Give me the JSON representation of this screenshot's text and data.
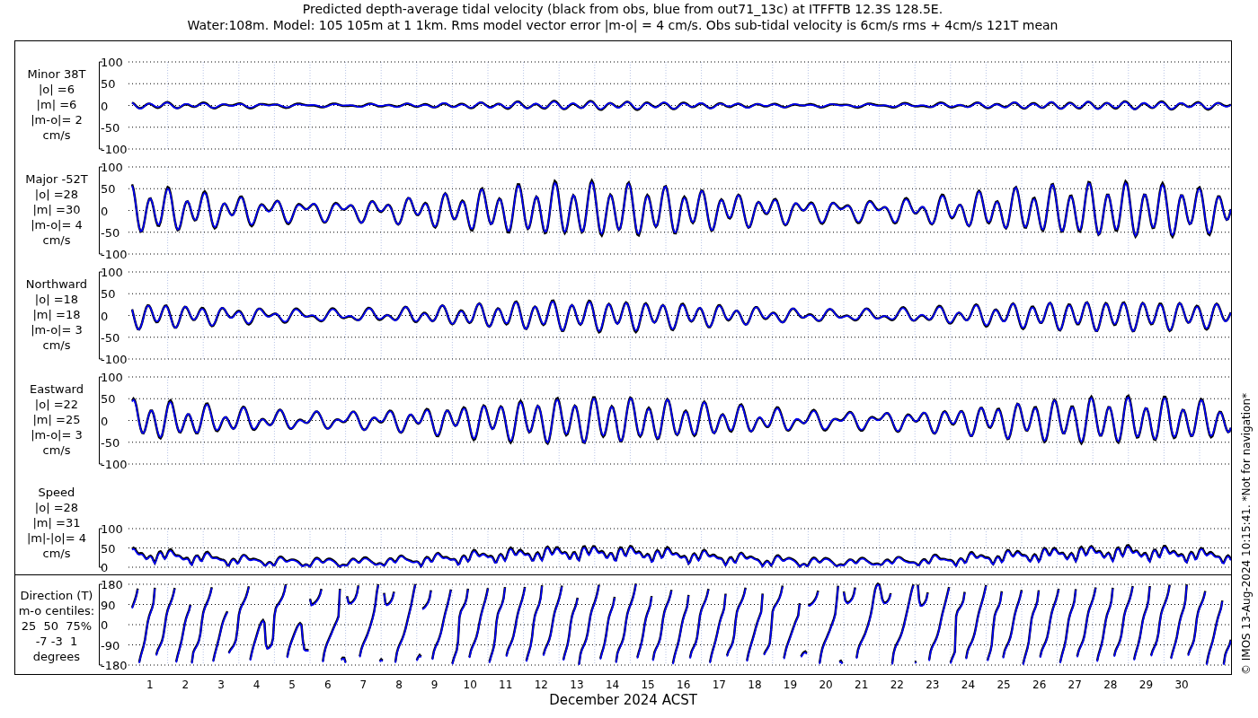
{
  "title": [
    "Predicted depth-average tidal velocity (black from obs, blue from out71_13c) at ITFFTB 12.3S 128.5E.",
    "Water:108m. Model: 105 105m at 1 1km. Rms model vector error |m-o| = 4 cm/s. Obs sub-tidal velocity is 6cm/s rms + 4cm/s 121T mean"
  ],
  "panels": [
    {
      "kind": "velocity",
      "label": [
        "Minor 38T",
        "|o| =6",
        "|m| =6",
        "|m-o|= 2",
        "cm/s"
      ],
      "yticks": [
        "100",
        "50",
        "0",
        "-50",
        "-100"
      ]
    },
    {
      "kind": "velocity",
      "label": [
        "Major -52T",
        "|o| =28",
        "|m| =30",
        "|m-o|= 4",
        "cm/s"
      ],
      "yticks": [
        "100",
        "50",
        "0",
        "-50",
        "-100"
      ]
    },
    {
      "kind": "velocity",
      "label": [
        "Northward",
        "|o| =18",
        "|m| =18",
        "|m-o|= 3",
        "cm/s"
      ],
      "yticks": [
        "100",
        "50",
        "0",
        "-50",
        "-100"
      ]
    },
    {
      "kind": "velocity",
      "label": [
        "Eastward",
        "|o| =22",
        "|m| =25",
        "|m-o|= 3",
        "cm/s"
      ],
      "yticks": [
        "100",
        "50",
        "0",
        "-50",
        "-100"
      ]
    },
    {
      "kind": "speed",
      "label": [
        "Speed",
        "|o| =28",
        "|m| =31",
        "|m|-|o|= 4",
        "cm/s"
      ],
      "yticks": [
        "100",
        "50",
        "0"
      ]
    },
    {
      "kind": "direction",
      "label": [
        "Direction (T)",
        "m-o centiles:",
        "25  50  75%",
        "-7 -3  1",
        "degrees"
      ],
      "yticks": [
        "180",
        "90",
        "0",
        "-90",
        "-180"
      ]
    }
  ],
  "xticks": [
    "1",
    "2",
    "3",
    "4",
    "5",
    "6",
    "7",
    "8",
    "9",
    "10",
    "11",
    "12",
    "13",
    "14",
    "15",
    "16",
    "17",
    "18",
    "19",
    "20",
    "21",
    "22",
    "23",
    "24",
    "25",
    "26",
    "27",
    "28",
    "29",
    "30"
  ],
  "xlabel": "December 2024 ACST",
  "credit": "© IMOS 13-Aug-2024 10:15:41. *Not for navigation*"
}
